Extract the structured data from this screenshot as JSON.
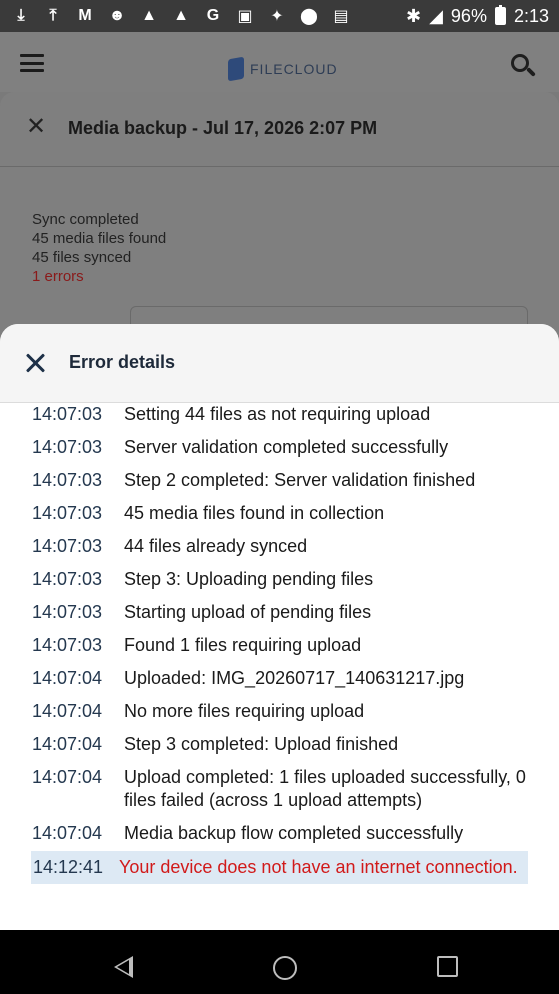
{
  "status_bar": {
    "left_icons": [
      "download-icon",
      "upload-icon",
      "gmail-icon",
      "app-icon",
      "warning-icon",
      "warning-icon",
      "google-icon",
      "gallery-icon",
      "game-icon",
      "location-icon",
      "news-icon"
    ],
    "right_icons": [
      "bluetooth-icon",
      "signal-icon",
      "battery-icon"
    ],
    "battery": "96%",
    "time": "2:13"
  },
  "app_header": {
    "logo_text": "FILECLOUD"
  },
  "backup_sheet": {
    "title": "Media backup - Jul 17, 2026 2:07 PM",
    "summary": {
      "line1": "Sync completed",
      "line2": "45 media files found",
      "line3": "45 files synced",
      "errors": "1 errors"
    }
  },
  "error_details": {
    "title": "Error details",
    "log": [
      {
        "time": "14:07:03",
        "message": "Setting 44 files as not requiring upload"
      },
      {
        "time": "14:07:03",
        "message": "Server validation completed successfully"
      },
      {
        "time": "14:07:03",
        "message": "Step 2 completed: Server validation finished"
      },
      {
        "time": "14:07:03",
        "message": "45 media files found in collection"
      },
      {
        "time": "14:07:03",
        "message": "44 files already synced"
      },
      {
        "time": "14:07:03",
        "message": "Step 3: Uploading pending files"
      },
      {
        "time": "14:07:03",
        "message": "Starting upload of pending files"
      },
      {
        "time": "14:07:03",
        "message": "Found 1 files requiring upload"
      },
      {
        "time": "14:07:04",
        "message": "Uploaded: IMG_20260717_140631217.jpg"
      },
      {
        "time": "14:07:04",
        "message": "No more files requiring upload"
      },
      {
        "time": "14:07:04",
        "message": "Step 3 completed: Upload finished"
      },
      {
        "time": "14:07:04",
        "message": "Upload completed: 1 files uploaded successfully, 0 files failed (across 1 upload attempts)"
      },
      {
        "time": "14:07:04",
        "message": "Media backup flow completed successfully"
      }
    ],
    "error_row": {
      "time": "14:12:41",
      "message": "Your device does not have an internet connection."
    }
  },
  "colors": {
    "error_text": "#d11a1a",
    "error_row_bg": "#dde9f4",
    "time_text": "#24384f"
  }
}
